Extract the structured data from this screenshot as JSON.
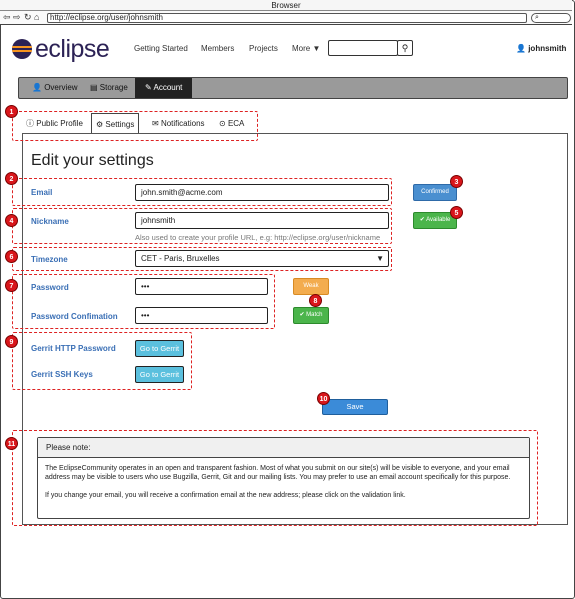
{
  "browser": {
    "title": "Browser",
    "url": "http://eclipse.org/user/johnsmith",
    "nav_icons": [
      "back-icon",
      "forward-icon",
      "refresh-icon",
      "home-icon"
    ]
  },
  "header": {
    "logo": "eclipse",
    "nav": [
      "Getting Started",
      "Members",
      "Projects",
      "More"
    ],
    "search_icon": "search-icon",
    "user": "johnsmith"
  },
  "account_tabs": [
    {
      "label": "Overview",
      "icon": "user-icon"
    },
    {
      "label": "Storage",
      "icon": "storage-icon"
    },
    {
      "label": "Account",
      "icon": "pencil-icon",
      "active": true
    }
  ],
  "sub_tabs": [
    {
      "label": "Public Profile",
      "icon": "info-icon"
    },
    {
      "label": "Settings",
      "icon": "gear-icon",
      "active": true
    },
    {
      "label": "Notifications",
      "icon": "envelope-icon"
    },
    {
      "label": "ECA",
      "icon": "check-circle-icon"
    }
  ],
  "page": {
    "title": "Edit your settings",
    "email_label": "Email",
    "email_value": "john.smith@acme.com",
    "email_status": "Confirmed",
    "nickname_label": "Nickname",
    "nickname_value": "johnsmith",
    "nickname_help": "Also used to create your profile URL, e.g: http://eclipse.org/user/nickname",
    "nickname_status": "Available",
    "timezone_label": "Timezone",
    "timezone_value": "CET - Paris, Bruxelles",
    "password_label": "Password",
    "password_value": "•••",
    "password_confirm_label": "Password Confimation",
    "password_confirm_value": "•••",
    "password_strength": "Weak",
    "password_match": "Match",
    "gerrit_http_label": "Gerrit HTTP Password",
    "gerrit_http_button": "Go to Gerrit",
    "gerrit_ssh_label": "Gerrit SSH Keys",
    "gerrit_ssh_button": "Go to Gerrit",
    "save_button": "Save"
  },
  "note": {
    "title": "Please note:",
    "paragraph1": "The EclipseCommunity operates in an open and transparent fashion. Most of what you submit on our site(s) will be visible to everyone, and your email address may be visible to users who use Bugzilla, Gerrit, Git and our mailing lists. You may prefer to use an email account specifically for this purpose.",
    "paragraph2": "If you change your email, you will receive a confirmation email at the new address; please click on the validation link."
  },
  "annotations": [
    "1",
    "2",
    "3",
    "4",
    "5",
    "6",
    "7",
    "8",
    "9",
    "10",
    "11"
  ]
}
